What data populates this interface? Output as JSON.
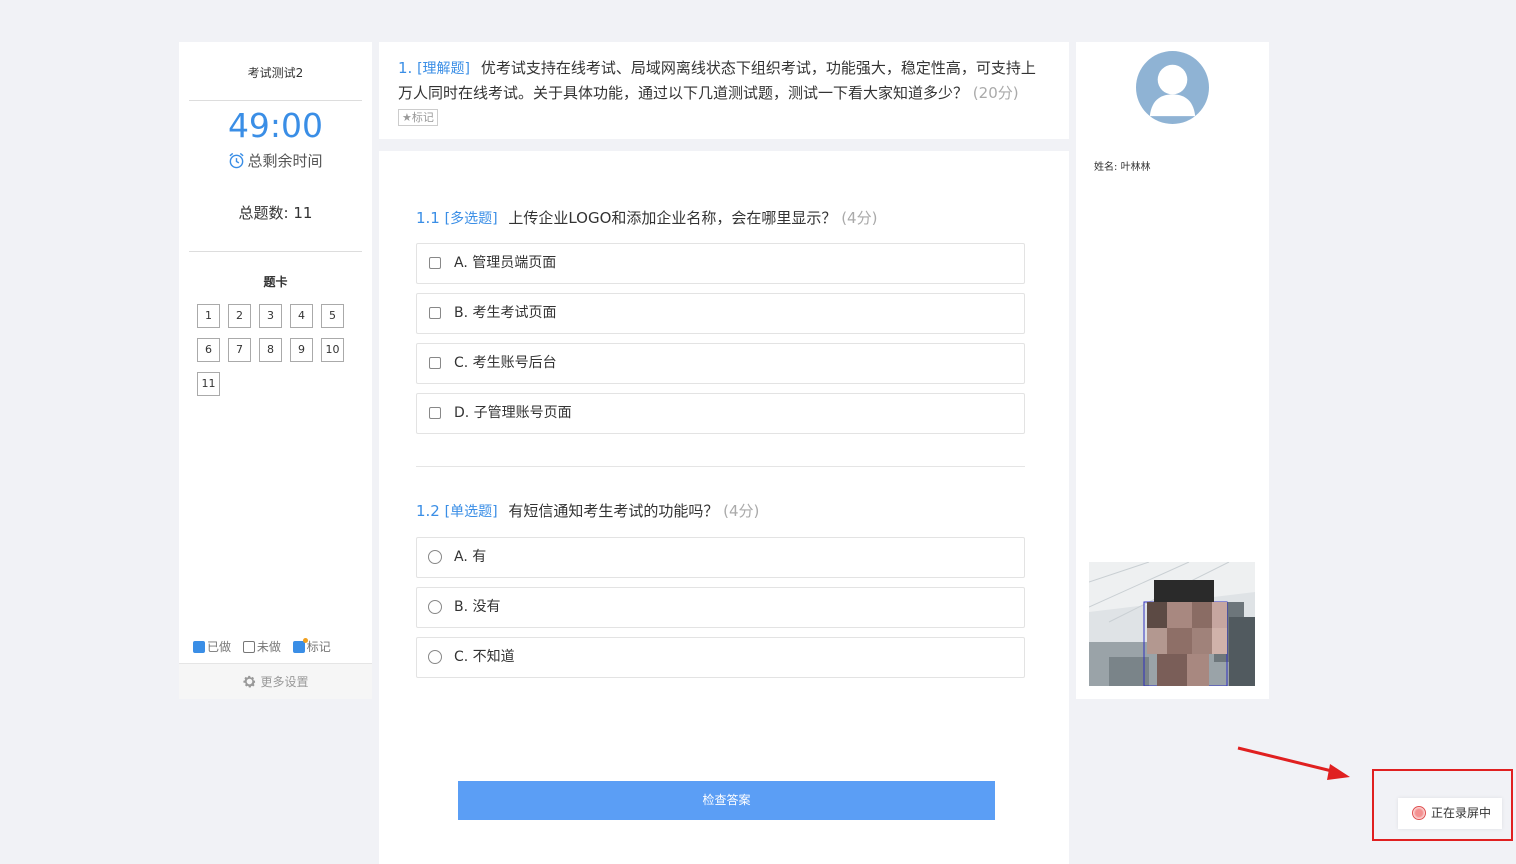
{
  "left_panel": {
    "exam_title": "考试测试2",
    "timer": "49:00",
    "timer_label": "总剩余时间",
    "total_questions": "总题数: 11",
    "card_title": "题卡",
    "question_numbers": [
      "1",
      "2",
      "3",
      "4",
      "5",
      "6",
      "7",
      "8",
      "9",
      "10",
      "11"
    ],
    "legend": {
      "done": "已做",
      "undone": "未做",
      "marked": "标记"
    },
    "more_settings": "更多设置"
  },
  "question": {
    "number": "1.",
    "type": "[理解题]",
    "text": "优考试支持在线考试、局域网离线状态下组织考试，功能强大，稳定性高，可支持上万人同时在线考试。关于具体功能，通过以下几道测试题，测试一下看大家知道多少？",
    "score": "(20分)",
    "mark_label": "标记"
  },
  "sub_questions": [
    {
      "number": "1.1",
      "type": "[多选题]",
      "text": "上传企业LOGO和添加企业名称，会在哪里显示？",
      "score": "(4分)",
      "options": [
        "A. 管理员端页面",
        "B. 考生考试页面",
        "C. 考生账号后台",
        "D. 子管理账号页面"
      ]
    },
    {
      "number": "1.2",
      "type": "[单选题]",
      "text": "有短信通知考生考试的功能吗？",
      "score": "(4分)",
      "options": [
        "A. 有",
        "B. 没有",
        "C. 不知道"
      ]
    }
  ],
  "check_button": "检查答案",
  "right_panel": {
    "name_label": "姓名:",
    "name_value": "叶林林"
  },
  "recording": {
    "label": "正在录屏中"
  },
  "colors": {
    "accent": "#3a8ee6",
    "button": "#5b9ef5",
    "annotation": "#e02020"
  }
}
